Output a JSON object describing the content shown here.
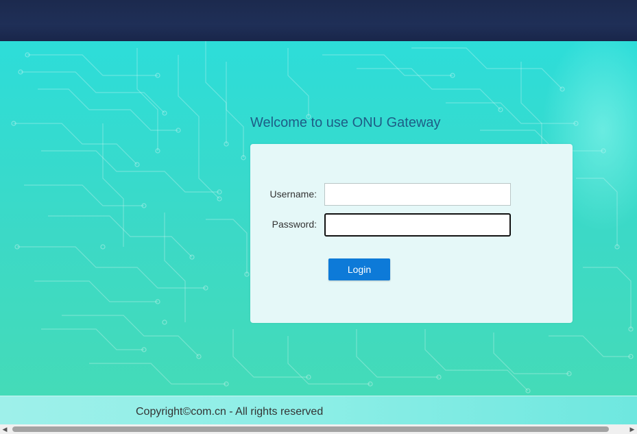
{
  "login": {
    "welcome": "Welcome to use ONU Gateway",
    "username_label": "Username:",
    "username_value": "",
    "password_label": "Password:",
    "password_value": "",
    "login_button": "Login"
  },
  "footer": {
    "copyright": "Copyright©com.cn - All rights reserved"
  },
  "scrollbar": {
    "left_icon": "scroll-left-arrow-icon",
    "right_icon": "scroll-right-arrow-icon"
  },
  "colors": {
    "header_bg": "#1f2f57",
    "background": "#3ed9c8",
    "panel_bg": "#e5f8f8",
    "welcome_text": "#1d5d86",
    "button_bg": "#0d7ad8",
    "button_text": "#ffffff"
  }
}
